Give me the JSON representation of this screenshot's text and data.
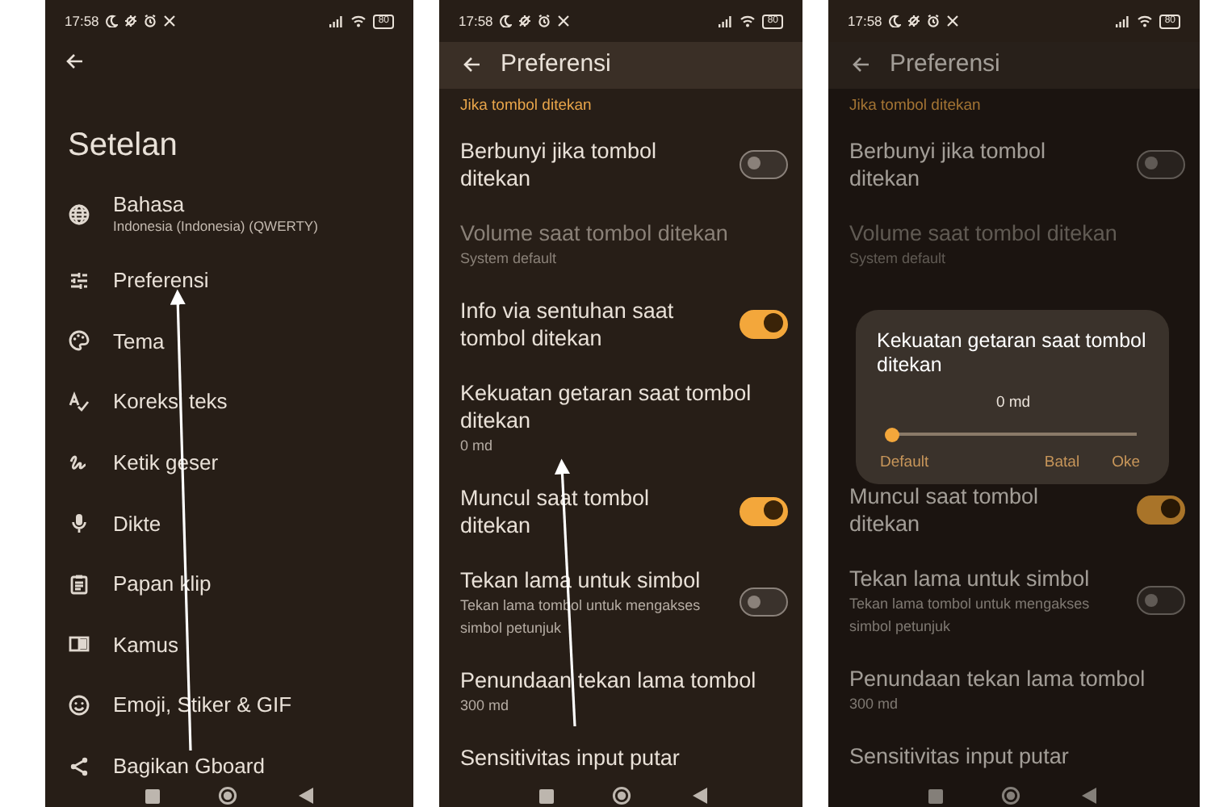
{
  "phones": [
    {
      "kind": "main",
      "dimmed": false,
      "status_bar": {
        "time": "17:58",
        "battery": "80"
      },
      "title": "Setelan",
      "items": [
        {
          "kind": "globe",
          "label": "Bahasa",
          "subtitle": "Indonesia (Indonesia) (QWERTY)"
        },
        {
          "kind": "sliders",
          "label": "Preferensi"
        },
        {
          "kind": "palette",
          "label": "Tema"
        },
        {
          "kind": "spell",
          "label": "Koreksi teks"
        },
        {
          "kind": "gesture",
          "label": "Ketik geser"
        },
        {
          "kind": "mic",
          "label": "Dikte"
        },
        {
          "kind": "clipboard",
          "label": "Papan klip"
        },
        {
          "kind": "book",
          "label": "Kamus"
        },
        {
          "kind": "smiley",
          "label": "Emoji, Stiker & GIF"
        },
        {
          "kind": "share",
          "label": "Bagikan Gboard"
        }
      ]
    },
    {
      "kind": "preferences",
      "dimmed": false,
      "status_bar": {
        "time": "17:58",
        "battery": "80"
      },
      "title": "Preferensi",
      "section": "Jika tombol ditekan",
      "items": [
        {
          "kind": "toggle",
          "label": "Berbunyi jika tombol ditekan",
          "on": false,
          "disabled": false
        },
        {
          "kind": "plain",
          "label": "Volume saat tombol ditekan",
          "subtitle": "System default",
          "disabled": true
        },
        {
          "kind": "toggle",
          "label": "Info via sentuhan saat tombol ditekan",
          "on": true,
          "disabled": false
        },
        {
          "kind": "plain",
          "label": "Kekuatan getaran saat tombol ditekan",
          "subtitle": "0 md",
          "disabled": false
        },
        {
          "kind": "toggle",
          "label": "Muncul saat tombol ditekan",
          "on": true,
          "disabled": false
        },
        {
          "kind": "toggle",
          "label": "Tekan lama untuk simbol",
          "subtitle": "Tekan lama tombol untuk mengakses simbol petunjuk",
          "on": false,
          "disabled": false
        },
        {
          "kind": "plain",
          "label": "Penundaan tekan lama tombol",
          "subtitle": "300 md",
          "disabled": false
        },
        {
          "kind": "plain",
          "label": "Sensitivitas input putar",
          "disabled": false
        }
      ]
    },
    {
      "kind": "preferences",
      "dimmed": true,
      "status_bar": {
        "time": "17:58",
        "battery": "80"
      },
      "title": "Preferensi",
      "section": "Jika tombol ditekan",
      "items": [
        {
          "kind": "toggle",
          "label": "Berbunyi jika tombol ditekan",
          "on": false,
          "disabled": false
        },
        {
          "kind": "plain",
          "label": "Volume saat tombol ditekan",
          "subtitle": "System default",
          "disabled": true
        },
        {
          "kind": "gap"
        },
        {
          "kind": "toggle",
          "label": "Muncul saat tombol ditekan",
          "on": true,
          "disabled": false
        },
        {
          "kind": "toggle",
          "label": "Tekan lama untuk simbol",
          "subtitle": "Tekan lama tombol untuk mengakses simbol petunjuk",
          "on": false,
          "disabled": false
        },
        {
          "kind": "plain",
          "label": "Penundaan tekan lama tombol",
          "subtitle": "300 md",
          "disabled": false
        },
        {
          "kind": "plain",
          "label": "Sensitivitas input putar",
          "disabled": false
        }
      ],
      "dialog": {
        "title": "Kekuatan getaran saat tombol ditekan",
        "reading": "0 md",
        "level": 0,
        "buttons": [
          "Default",
          "Batal",
          "Oke"
        ]
      }
    }
  ]
}
